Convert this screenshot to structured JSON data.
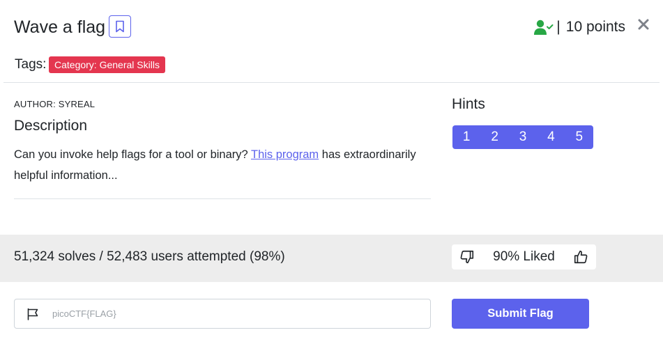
{
  "header": {
    "title": "Wave a flag",
    "points_separator": "|",
    "points_text": "10 points"
  },
  "tags": {
    "label": "Tags:",
    "items": [
      "Category: General Skills"
    ]
  },
  "challenge": {
    "author": "AUTHOR: SYREAL",
    "description_heading": "Description",
    "description_before_link": "Can you invoke help flags for a tool or binary? ",
    "description_link": "This program",
    "description_after_link": " has extraordinarily helpful information..."
  },
  "hints": {
    "heading": "Hints",
    "items": [
      "1",
      "2",
      "3",
      "4",
      "5"
    ]
  },
  "stats": {
    "solves_text": "51,324 solves / 52,483 users attempted (98%)",
    "liked_text": "90% Liked"
  },
  "flag_form": {
    "placeholder": "picoCTF{FLAG}",
    "value": "",
    "submit_label": "Submit Flag"
  },
  "colors": {
    "accent": "#5c62ec",
    "badge": "#e4364f",
    "solved_icon": "#28a745",
    "stats_band": "#ededed"
  },
  "icons": {
    "bookmark": "bookmark-icon",
    "solved": "user-check-icon",
    "close": "close-icon",
    "dislike": "thumbs-down-icon",
    "like": "thumbs-up-icon",
    "flag": "flag-icon"
  }
}
